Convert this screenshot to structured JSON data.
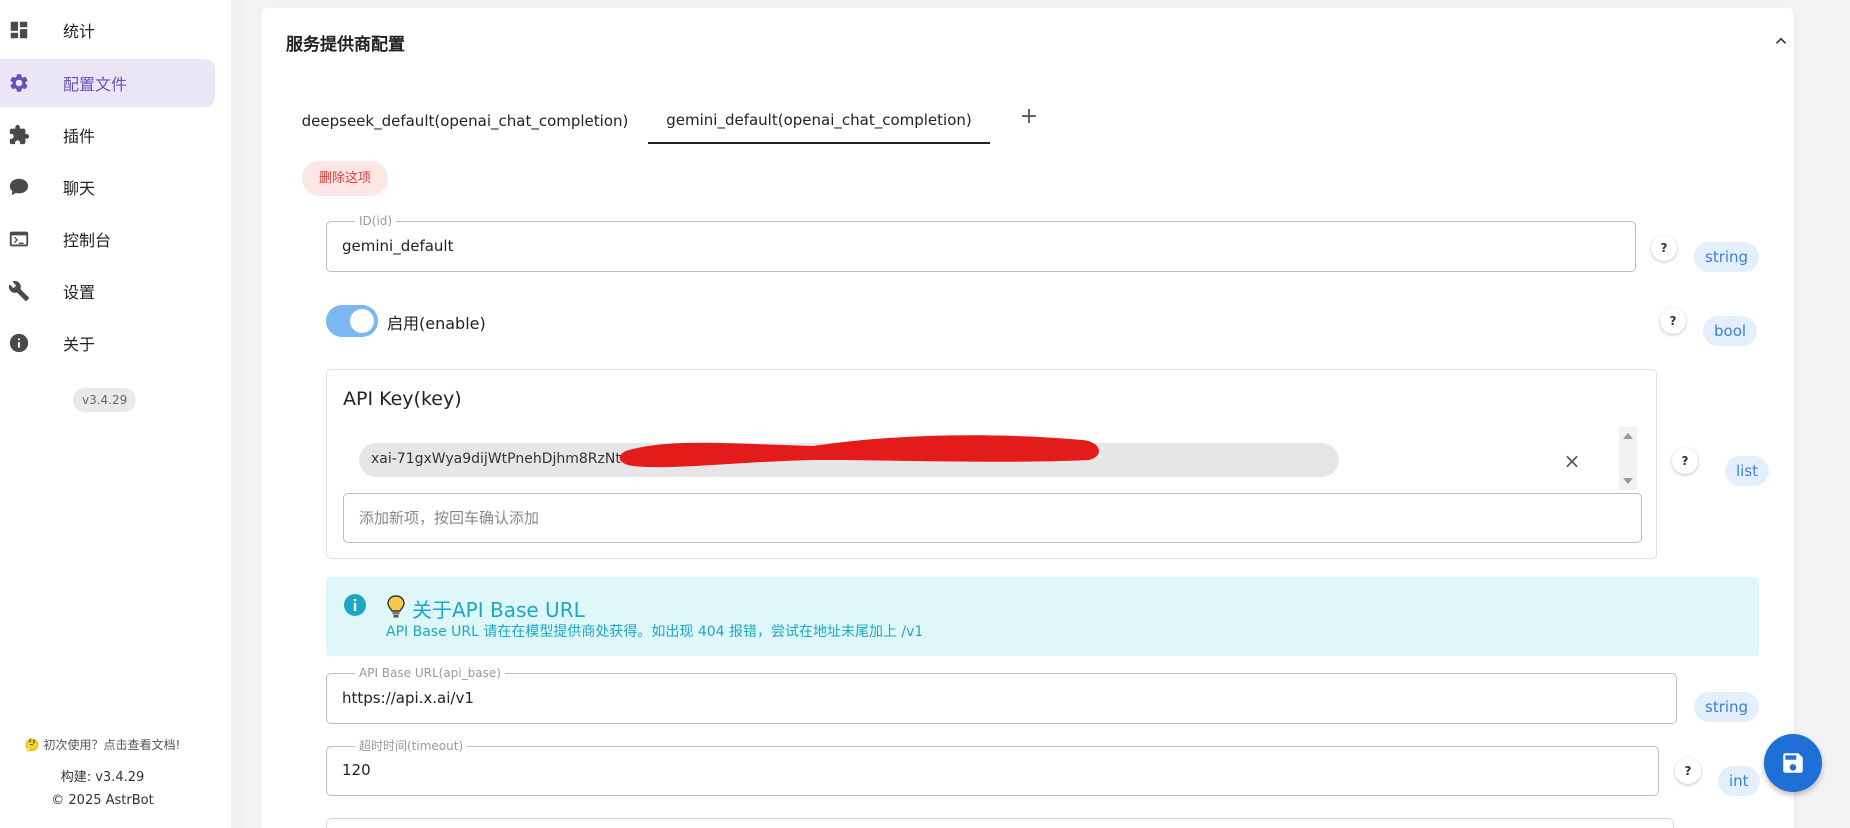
{
  "sidebar": {
    "items": [
      {
        "label": "统计",
        "icon": "dashboard-icon",
        "active": false
      },
      {
        "label": "配置文件",
        "icon": "gear-icon",
        "active": true
      },
      {
        "label": "插件",
        "icon": "puzzle-icon",
        "active": false
      },
      {
        "label": "聊天",
        "icon": "chat-icon",
        "active": false
      },
      {
        "label": "控制台",
        "icon": "terminal-icon",
        "active": false
      },
      {
        "label": "设置",
        "icon": "wrench-icon",
        "active": false
      },
      {
        "label": "关于",
        "icon": "info-icon",
        "active": false
      }
    ],
    "version": "v3.4.29",
    "help_text": "🤔 初次使用？点击查看文档!",
    "build": "构建: v3.4.29",
    "copyright": "© 2025 AstrBot"
  },
  "card": {
    "title": "服务提供商配置"
  },
  "tabs": [
    {
      "label": "deepseek_default(openai_chat_completion)",
      "active": false
    },
    {
      "label": "gemini_default(openai_chat_completion)",
      "active": true
    }
  ],
  "tab_add_label": "+",
  "delete_button": "删除这项",
  "fields": {
    "id": {
      "legend": "ID(id)",
      "value": "gemini_default",
      "type": "string",
      "help": "?"
    },
    "enable": {
      "label": "启用(enable)",
      "value": true,
      "type": "bool",
      "help": "?"
    },
    "api_key": {
      "title": "API Key(key)",
      "items": [
        "xai-71gxWya9dijWtPnehDjhm8RzNt"
      ],
      "placeholder": "添加新项，按回车确认添加",
      "type": "list",
      "help": "?"
    },
    "api_base": {
      "legend": "API Base URL(api_base)",
      "value": "https://api.x.ai/v1",
      "type": "string"
    },
    "timeout": {
      "legend": "超时时间(timeout)",
      "value": "120",
      "type": "int",
      "help": "?"
    }
  },
  "alert": {
    "title": "关于API Base URL",
    "text": "API Base URL 请在在模型提供商处获得。如出现 404 报错，尝试在地址末尾加上 /v1"
  },
  "colors": {
    "accent": "#6a4fb8",
    "primary": "#1e6fd6",
    "danger": "#e23b3b",
    "info": "#1aa9c4"
  }
}
